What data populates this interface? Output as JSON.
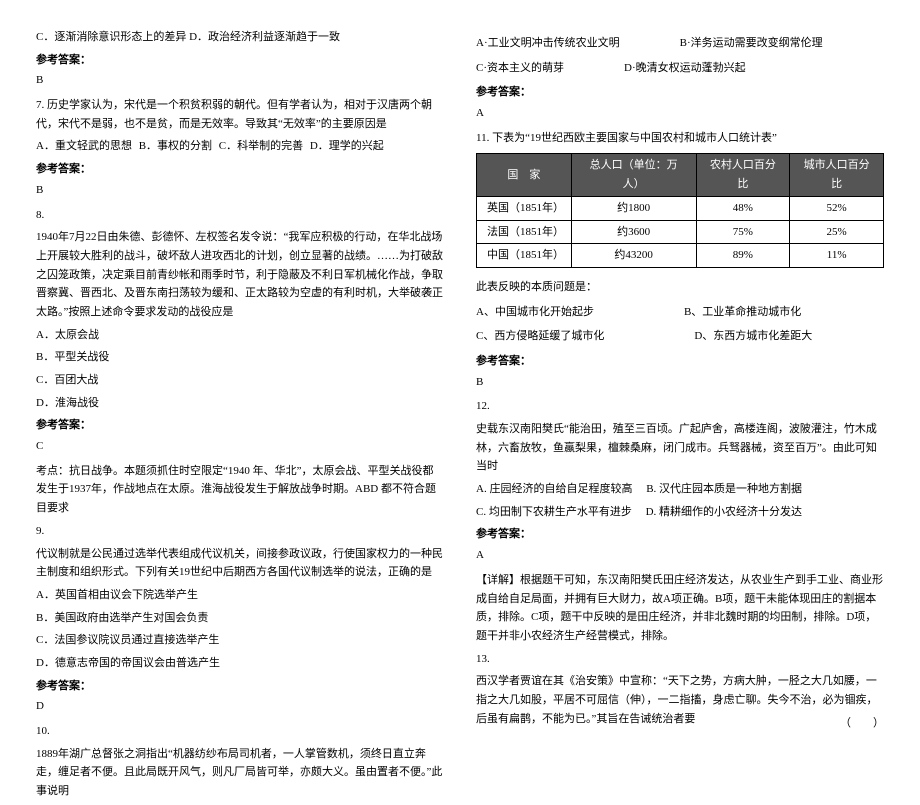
{
  "left": {
    "q6tail": "C．逐渐消除意识形态上的差异      D．政治经济利益逐渐趋于一致",
    "ans6label": "参考答案：",
    "ans6val": "B",
    "q7": "7. 历史学家认为，宋代是一个积贫积弱的朝代。但有学者认为，相对于汉唐两个朝代，宋代不是弱，也不是贫，而是无效率。导致其“无效率”的主要原因是",
    "q7opts": "A．重文轻武的思想      B．事权的分割      C．科举制的完善      D．理学的兴起",
    "ans7label": "参考答案：",
    "ans7val": "B",
    "q8num": "8.",
    "q8body": "1940年7月22日由朱德、彭德怀、左权签名发令说：“我军应积极的行动，在华北战场上开展较大胜利的战斗，破坏敌人进攻西北的计划，创立显著的战绩。……为打破敌之囚笼政策，决定乘目前青纱帐和雨季时节，利于隐蔽及不利日军机械化作战，争取晋察冀、晋西北、及晋东南扫荡较为缓和、正太路较为空虚的有利时机，大举破袭正太路。”按照上述命令要求发动的战役应是",
    "q8a": "A．太原会战",
    "q8b": "B．平型关战役",
    "q8c": "C．百团大战",
    "q8d": "D．淮海战役",
    "ans8label": "参考答案：",
    "ans8val": "C",
    "q8expl": "考点：抗日战争。本题须抓住时空限定“1940 年、华北”，太原会战、平型关战役都发生于1937年，作战地点在太原。淮海战役发生于解放战争时期。ABD 都不符合题目要求",
    "q9num": "9.",
    "q9body": "代议制就是公民通过选举代表组成代议机关，间接参政议政，行使国家权力的一种民主制度和组织形式。下列有关19世纪中后期西方各国代议制选举的说法，正确的是",
    "q9a": "A．英国首相由议会下院选举产生",
    "q9b": "B．美国政府由选举产生对国会负责",
    "q9c": "C．法国参议院议员通过直接选举产生",
    "q9d": "D．德意志帝国的帝国议会由普选产生",
    "ans9label": "参考答案：",
    "ans9val": "D",
    "q10num": "10.",
    "q10body": "1889年湖广总督张之洞指出“机器纺纱布局司机者，一人掌管数机，须终日直立奔走，缠足者不便。且此局既开风气，则凡厂局皆可举，亦颇大义。虽由置者不便。”此事说明"
  },
  "right": {
    "q10a": "A·工业文明冲击传统农业文明",
    "q10b": "B·洋务运动需要改变纲常伦理",
    "q10c": "C·资本主义的萌芽",
    "q10d": "D·晚清女权运动蓬勃兴起",
    "ans10label": "参考答案：",
    "ans10val": "A",
    "q11": "11. 下表为“19世纪西欧主要国家与中国农村和城市人口统计表”",
    "table": {
      "h1": "国　家",
      "h2": "总人口（单位：万人）",
      "h3": "农村人口百分比",
      "h4": "城市人口百分比",
      "r1c1": "英国（1851年）",
      "r1c2": "约1800",
      "r1c3": "48%",
      "r1c4": "52%",
      "r2c1": "法国（1851年）",
      "r2c2": "约3600",
      "r2c3": "75%",
      "r2c4": "25%",
      "r3c1": "中国（1851年）",
      "r3c2": "约43200",
      "r3c3": "89%",
      "r3c4": "11%"
    },
    "q11prompt": "此表反映的本质问题是：",
    "q11a": "A、中国城市化开始起步",
    "q11b": "B、工业革命推动城市化",
    "q11c": "C、西方侵略延缓了城市化",
    "q11d": "D、东西方城市化差距大",
    "ans11label": "参考答案：",
    "ans11val": "B",
    "q12num": "12.",
    "q12body": "史载东汉南阳樊氏“能治田，殖至三百顷。广起庐舍，高楼连阁，波陂灌注，竹木成林，六畜放牧，鱼蠃梨果，檀棘桑麻，闭门成市。兵驽器械，资至百万”。由此可知当时",
    "q12a": "A. 庄园经济的自给自足程度较高",
    "q12b": "B. 汉代庄园本质是一种地方割据",
    "q12c": "C. 均田制下农耕生产水平有进步",
    "q12d": "D. 精耕细作的小农经济十分发达",
    "ans12label": "参考答案：",
    "ans12val": "A",
    "q12expl": "【详解】根据题干可知，东汉南阳樊氏田庄经济发达，从农业生产到手工业、商业形成自给自足局面，并拥有巨大财力，故A项正确。B项，题干未能体现田庄的割据本质，排除。C项，题干中反映的是田庄经济，并非北魏时期的均田制，排除。D项，题干并非小农经济生产经营模式，排除。",
    "q13num": "13.",
    "q13body": "西汉学者贾谊在其《治安策》中宣称：“天下之势，方病大肿，一胫之大几如腰，一指之大几如股，平居不可屈信（伸），一二指搐，身虑亡聊。失今不治，必为锢疾，后虽有扁鹊，不能为已。”其旨在告诫统治者要",
    "q13paren": "（　　）"
  }
}
